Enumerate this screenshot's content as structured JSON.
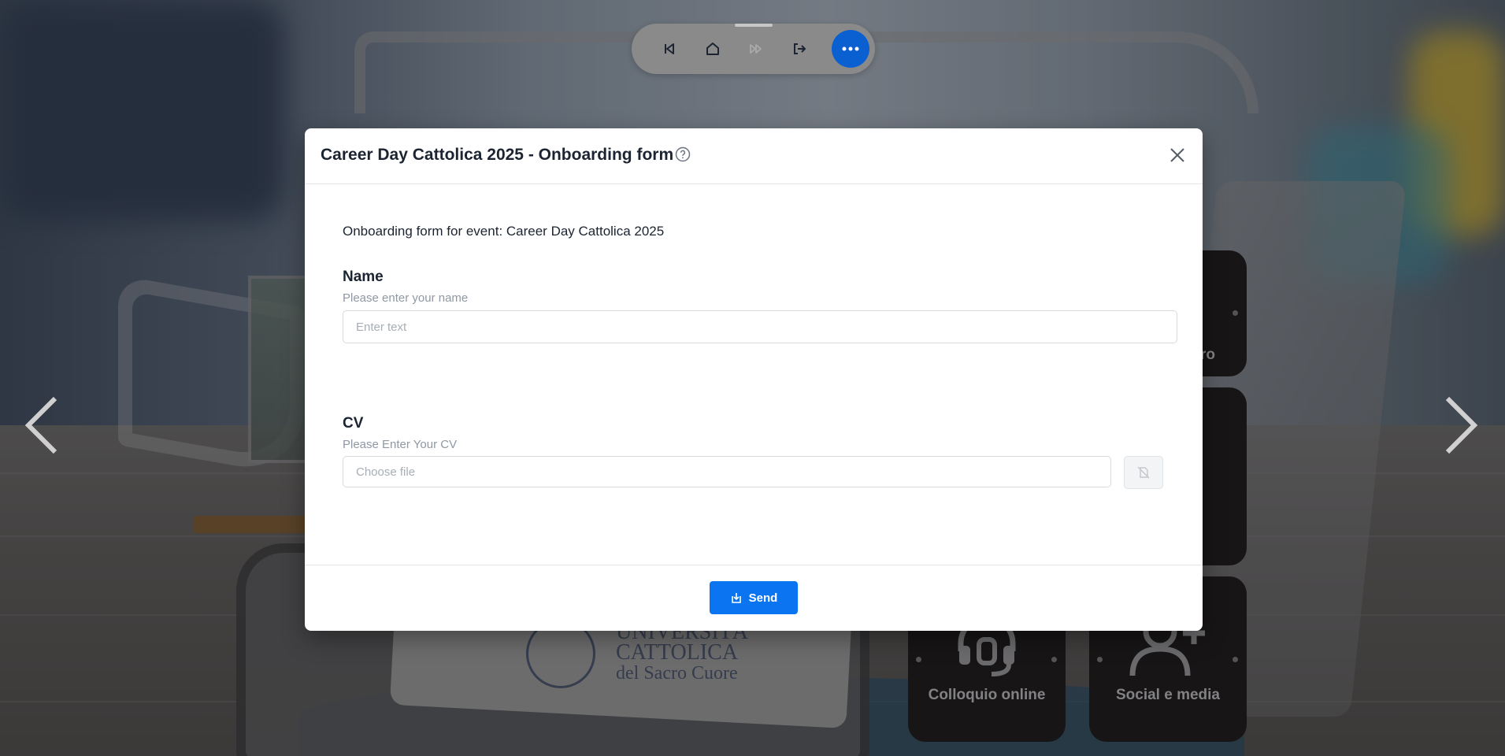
{
  "toolbar": {
    "buttons": [
      {
        "name": "previous",
        "icon": "skip-back-icon"
      },
      {
        "name": "home",
        "icon": "home-icon"
      },
      {
        "name": "next",
        "icon": "fast-forward-icon",
        "disabled": true
      },
      {
        "name": "exit",
        "icon": "logout-icon"
      }
    ],
    "more_icon": "more-dots-icon",
    "accent": "#0a5fd1"
  },
  "booth": {
    "tiles": [
      {
        "label": "Colloquio online",
        "icon": "headset-icon"
      },
      {
        "label": "Social e media",
        "icon": "add-user-icon"
      }
    ],
    "partial_tile_label": "ro",
    "university_logo": {
      "lines": [
        "UNIVERSITÀ",
        "CATTOLICA",
        "del Sacro Cuore"
      ]
    }
  },
  "modal": {
    "title": "Career Day Cattolica 2025 - Onboarding form",
    "intro": "Onboarding form for event: Career Day Cattolica 2025",
    "fields": {
      "name": {
        "label": "Name",
        "hint": "Please enter your name",
        "placeholder": "Enter text",
        "value": ""
      },
      "cv": {
        "label": "CV",
        "hint": "Please Enter Your CV",
        "placeholder": "Choose file"
      }
    },
    "send_label": "Send",
    "primary_color": "#0b74f0"
  }
}
